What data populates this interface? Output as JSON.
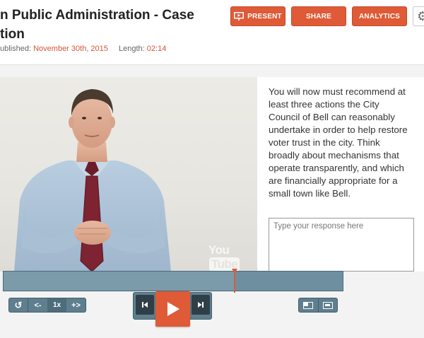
{
  "header": {
    "title_line1": "n Public Administration - Case",
    "title_line2": "tion",
    "published_label": "ublished:",
    "published_value": "November 30th, 2015",
    "length_label": "Length:",
    "length_value": "02:14"
  },
  "toolbar": {
    "present_label": "PRESENT",
    "share_label": "SHARE",
    "analytics_label": "ANALYTICS",
    "present_icon": "presentation-screen-icon",
    "settings_icon": "gear-icon"
  },
  "video": {
    "watermark_you": "You",
    "watermark_tube": "Tube"
  },
  "prompt": {
    "text": "You will now must recommend at least three actions the City Council of Bell can reasonably undertake in order to help restore voter trust in the city. Think broadly about mechanisms that operate transparently, and which are financially appropriate for a small town like Bell.",
    "response_placeholder": "Type your response here",
    "response_value": ""
  },
  "player": {
    "progress_fraction": 0.68,
    "speed_label": "1x",
    "slower_label": "<-",
    "faster_label": "+>",
    "replay_icon": "replay-icon",
    "prev_icon": "skip-previous-icon",
    "play_icon": "play-icon",
    "next_icon": "skip-next-icon"
  },
  "colors": {
    "accent": "#df5a37",
    "control": "#5f7f8f",
    "timeline": "#6e8fa0"
  }
}
